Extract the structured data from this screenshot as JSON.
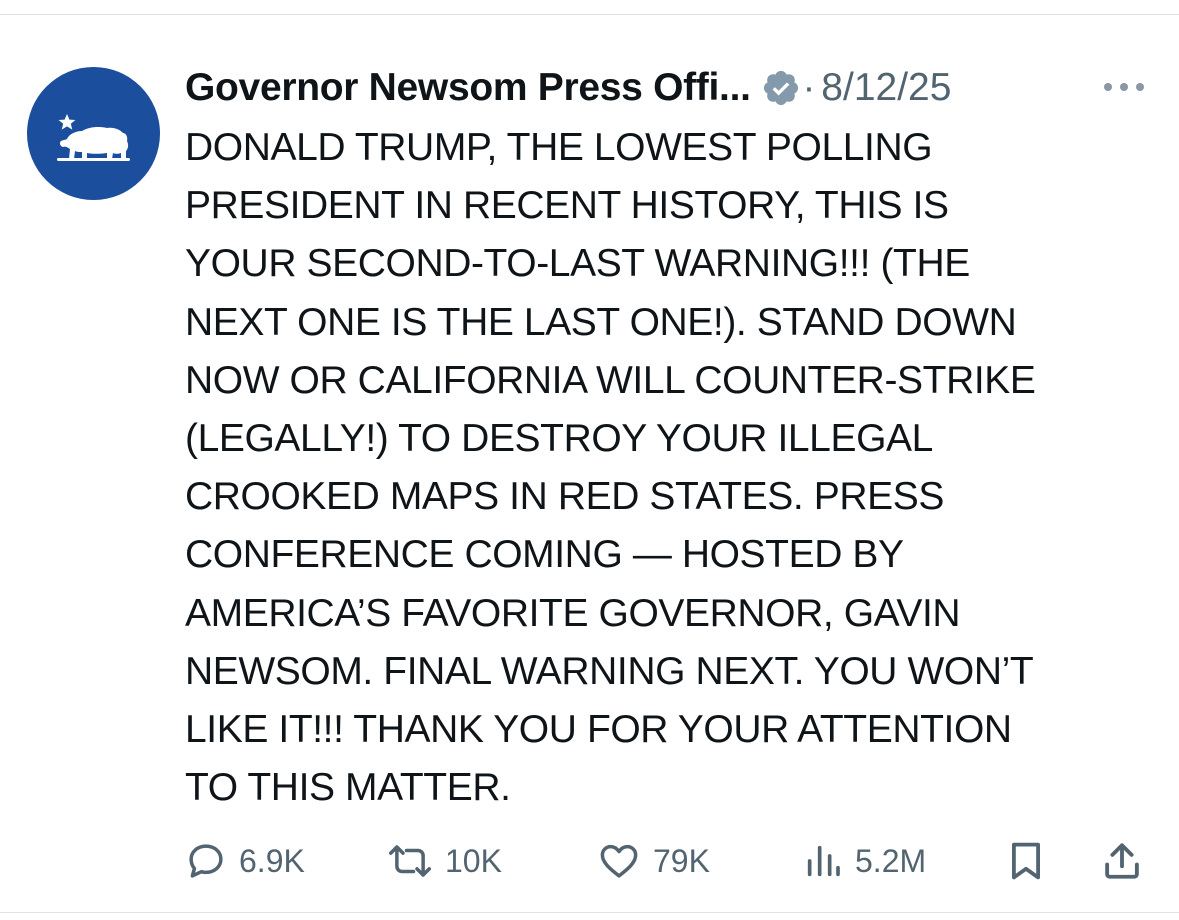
{
  "tweet": {
    "author_name": "Governor Newsom Press Offi...",
    "separator": "·",
    "date": "8/12/25",
    "text": "DONALD TRUMP, THE LOWEST POLLING\nPRESIDENT IN RECENT HISTORY, THIS IS\nYOUR SECOND-TO-LAST WARNING!!! (THE\nNEXT ONE IS THE LAST ONE!). STAND DOWN\nNOW OR CALIFORNIA WILL COUNTER-STRIKE\n(LEGALLY!) TO DESTROY YOUR ILLEGAL\nCROOKED MAPS IN RED STATES. PRESS\nCONFERENCE COMING — HOSTED BY\nAMERICA’S FAVORITE GOVERNOR, GAVIN\nNEWSOM. FINAL WARNING NEXT. YOU WON’T\nLIKE IT!!! THANK YOU FOR YOUR ATTENTION\nTO THIS MATTER.",
    "avatar_icon": "california-bear-icon",
    "verified_icon": "verified-badge-icon",
    "more_icon": "more-options-icon"
  },
  "actions": {
    "replies": {
      "icon": "reply-icon",
      "count": "6.9K"
    },
    "reposts": {
      "icon": "repost-icon",
      "count": "10K"
    },
    "likes": {
      "icon": "like-icon",
      "count": "79K"
    },
    "views": {
      "icon": "views-icon",
      "count": "5.2M"
    },
    "bookmark": {
      "icon": "bookmark-icon"
    },
    "share": {
      "icon": "share-icon"
    }
  },
  "colors": {
    "avatar_bg": "#1b4f9e",
    "text_primary": "#0f1419",
    "text_secondary": "#536471",
    "verified": "#829aab",
    "divider": "#dfe3e7"
  }
}
